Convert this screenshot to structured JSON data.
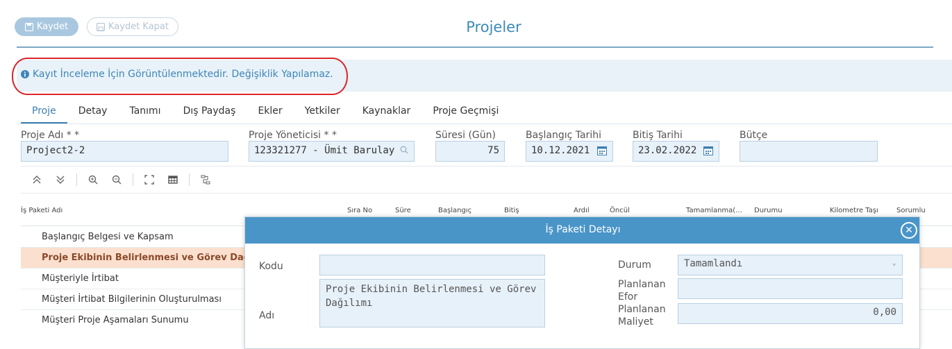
{
  "toolbar": {
    "save_label": "Kaydet",
    "save_close_label": "Kaydet Kapat"
  },
  "page": {
    "title": "Projeler"
  },
  "info": {
    "message": "Kayıt İnceleme İçin Görüntülenmektedir. Değişiklik Yapılamaz."
  },
  "tabs": [
    "Proje",
    "Detay",
    "Tanımı",
    "Dış Paydaş",
    "Ekler",
    "Yetkiler",
    "Kaynaklar",
    "Proje Geçmişi"
  ],
  "form": {
    "proje_adi": {
      "label": "Proje Adı * *",
      "value": "Project2-2"
    },
    "yonetici": {
      "label": "Proje Yöneticisi * *",
      "value": "123321277 - Ümit Barulay"
    },
    "suresi": {
      "label": "Süresi (Gün)",
      "value": "75"
    },
    "baslangic": {
      "label": "Başlangıç Tarihi",
      "value": "10.12.2021"
    },
    "bitis": {
      "label": "Bitiş Tarihi",
      "value": "23.02.2022"
    },
    "butce": {
      "label": "Bütçe",
      "value": ""
    }
  },
  "grid": {
    "columns": [
      "İş Paketi Adı",
      "Sıra No",
      "Süre",
      "Başlangıç",
      "Bitiş",
      "Ardıl",
      "Öncül",
      "Tamamlanma(...",
      "Durumu",
      "Kilometre Taşı",
      "Sorumlu"
    ],
    "rows": [
      "Başlangıç Belgesi ve Kapsam",
      "Proje Ekibinin Belirlenmesi ve Görev Dağılımı",
      "Müşteriyle İrtibat",
      "Müşteri İrtibat Bilgilerinin Oluşturulması",
      "Müşteri Proje Aşamaları Sunumu"
    ],
    "selected_row": 1
  },
  "modal": {
    "title": "İş Paketi Detayı",
    "kodu_label": "Kodu",
    "kodu_value": "",
    "adi_label": "Adı",
    "adi_value": "Proje Ekibinin Belirlenmesi ve Görev Dağılımı",
    "durum_label": "Durum",
    "durum_value": "Tamamlandı",
    "efor_label": "Planlanan Efor",
    "efor_value": "",
    "maliyet_label": "Planlanan Maliyet",
    "maliyet_value": "0,00"
  },
  "colors": {
    "accent": "#3d8ab8",
    "highlight": "#d9262b",
    "selected_row": "#fbe0cf",
    "modal_header": "#4a95c8"
  }
}
